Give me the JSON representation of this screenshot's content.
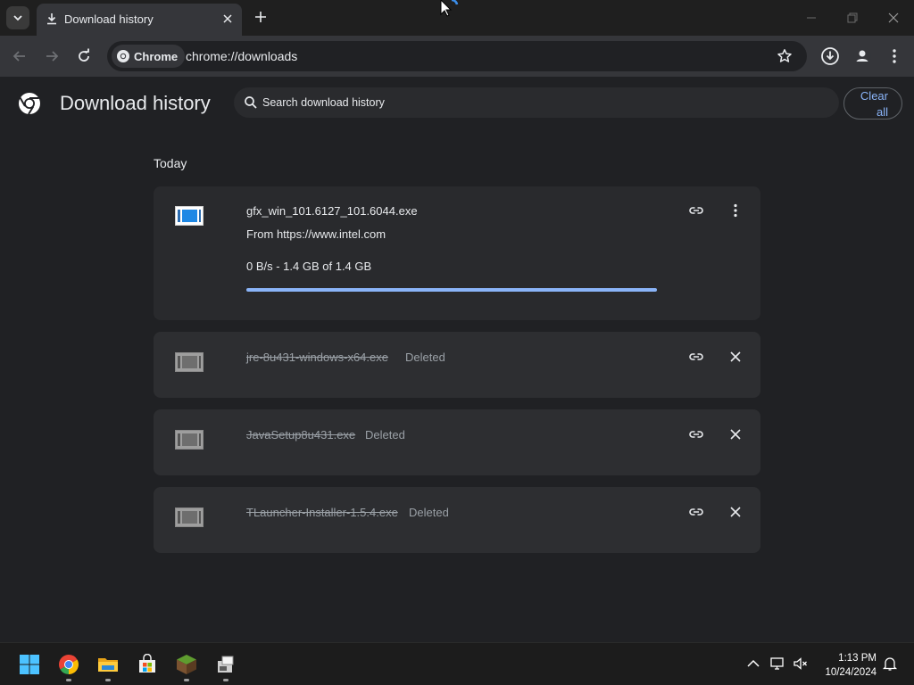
{
  "browser": {
    "tab_title": "Download history",
    "chip_label": "Chrome",
    "url": "chrome://downloads"
  },
  "downloads_page": {
    "title": "Download history",
    "search_placeholder": "Search download history",
    "clear_all_line1": "Clear",
    "clear_all_line2": "all",
    "section_label": "Today",
    "items": [
      {
        "name": "gfx_win_101.6127_101.6044.exe",
        "source": "From https://www.intel.com",
        "progress_text": "0 B/s - 1.4 GB of 1.4 GB",
        "progress_fraction": 1.0,
        "state": "active"
      },
      {
        "name": "jre-8u431-windows-x64.exe",
        "status": "Deleted",
        "state": "deleted"
      },
      {
        "name": "JavaSetup8u431.exe",
        "status": "Deleted",
        "state": "deleted"
      },
      {
        "name": "TLauncher-Installer-1.5.4.exe",
        "status": "Deleted",
        "state": "deleted"
      }
    ]
  },
  "taskbar": {
    "time": "1:13 PM",
    "date": "10/24/2024",
    "apps": [
      "windows-start-icon",
      "chrome-icon",
      "file-explorer-icon",
      "microsoft-store-icon",
      "minecraft-icon",
      "installer-icon"
    ]
  },
  "colors": {
    "accent": "#8ab4f8",
    "background": "#202124",
    "card": "#2d2e31"
  }
}
